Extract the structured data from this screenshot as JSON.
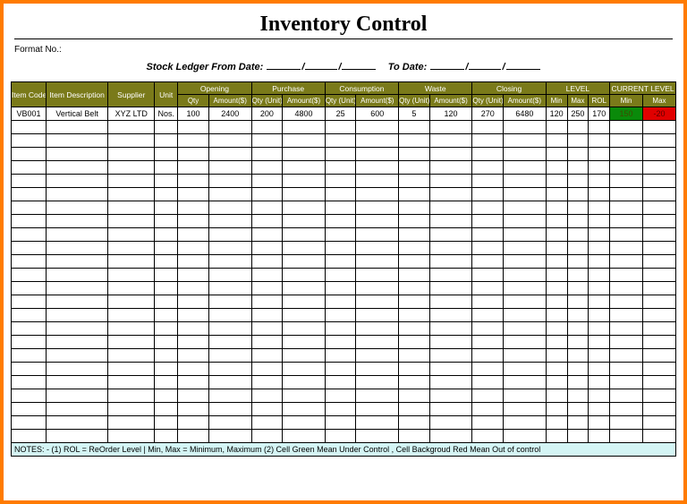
{
  "title": "Inventory Control",
  "format_label": "Format No.:",
  "ledger": {
    "prefix": "Stock Ledger From Date:",
    "to": "To Date:"
  },
  "columns": {
    "item_code": "Item Code",
    "item_desc": "Item Description",
    "supplier": "Supplier",
    "unit": "Unit",
    "opening": "Opening",
    "purchase": "Purchase",
    "consumption": "Consumption",
    "waste": "Waste",
    "closing": "Closing",
    "level": "LEVEL",
    "current_level": "CURRENT LEVEL",
    "qty": "Qty",
    "amount": "Amount($)",
    "qty_unit": "Qty (Unit)",
    "min": "Min",
    "max": "Max",
    "rol": "ROL"
  },
  "rows": [
    {
      "item_code": "VB001",
      "item_desc": "Vertical Belt",
      "supplier": "XYZ LTD",
      "unit": "Nos.",
      "opening_qty": "100",
      "opening_amt": "2400",
      "purchase_qty": "200",
      "purchase_amt": "4800",
      "consumption_qty": "25",
      "consumption_amt": "600",
      "waste_qty": "5",
      "waste_amt": "120",
      "closing_qty": "270",
      "closing_amt": "6480",
      "lvl_min": "120",
      "lvl_max": "250",
      "lvl_rol": "170",
      "cur_min": "150",
      "cur_max": "-20"
    }
  ],
  "empty_row_count": 24,
  "notes": "NOTES: - (1) ROL = ReOrder Level | Min, Max = Minimum, Maximum     (2) Cell Green Mean Under Control , Cell Backgroud Red Mean Out of control"
}
